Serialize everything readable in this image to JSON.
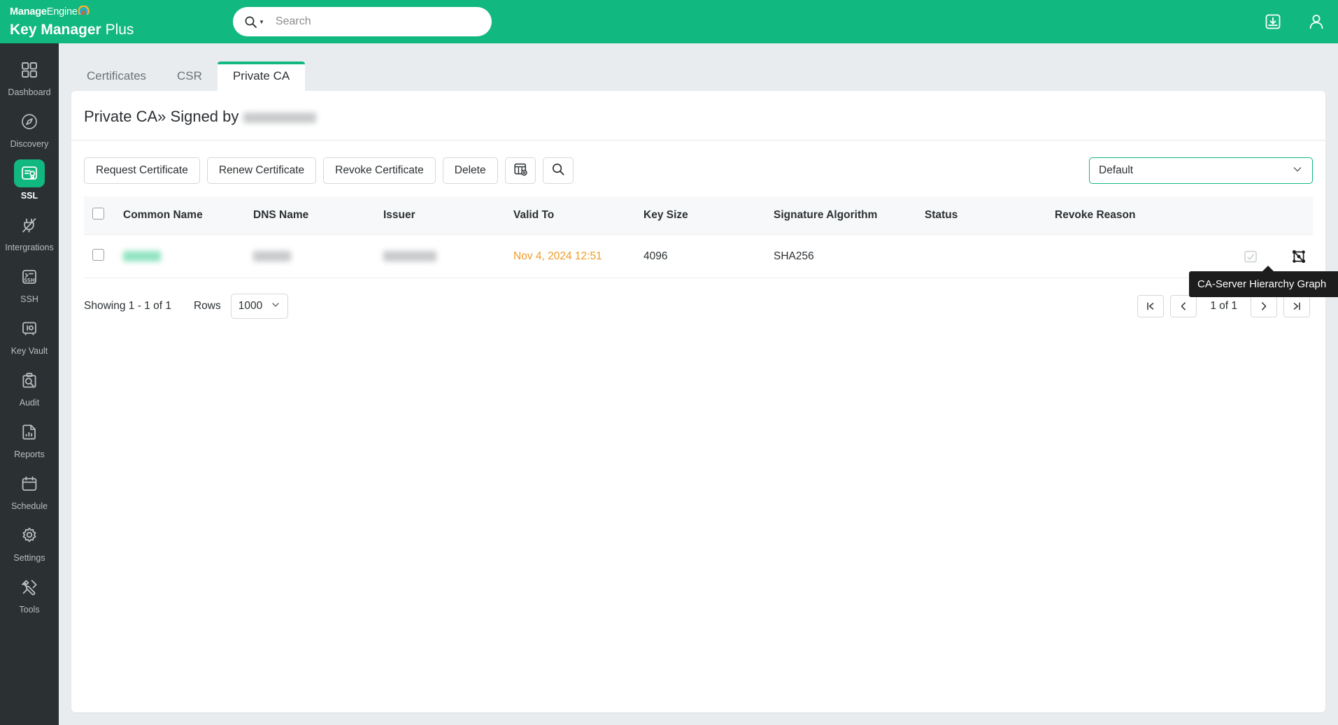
{
  "brand": {
    "company_bold": "Manage",
    "company_thin": "Engine",
    "product_bold": "Key Manager",
    "product_thin": "Plus"
  },
  "search": {
    "placeholder": "Search",
    "value": "",
    "icon": "search-icon",
    "caret_icon": "caret-down-icon"
  },
  "topbar": {
    "actions": [
      {
        "name": "inbox-download-icon",
        "label": ""
      },
      {
        "name": "user-account-icon",
        "label": ""
      }
    ]
  },
  "sidebar": {
    "items": [
      {
        "label": "Dashboard",
        "icon": "grid-icon",
        "active": false
      },
      {
        "label": "Discovery",
        "icon": "compass-icon",
        "active": false
      },
      {
        "label": "SSL",
        "icon": "certificate-badge-icon",
        "active": true
      },
      {
        "label": "Intergrations",
        "icon": "plug-icon",
        "active": false
      },
      {
        "label": "SSH",
        "icon": "terminal-ssh-icon",
        "active": false
      },
      {
        "label": "Key Vault",
        "icon": "vault-icon",
        "active": false
      },
      {
        "label": "Audit",
        "icon": "clipboard-search-icon",
        "active": false
      },
      {
        "label": "Reports",
        "icon": "report-chart-icon",
        "active": false
      },
      {
        "label": "Schedule",
        "icon": "calendar-icon",
        "active": false
      },
      {
        "label": "Settings",
        "icon": "gear-icon",
        "active": false
      },
      {
        "label": "Tools",
        "icon": "tools-icon",
        "active": false
      }
    ]
  },
  "tabs": [
    {
      "label": "Certificates",
      "active": false
    },
    {
      "label": "CSR",
      "active": false
    },
    {
      "label": "Private CA",
      "active": true
    }
  ],
  "page": {
    "title_prefix": "Private CA",
    "title_separator": "»",
    "title_middle": "Signed by",
    "title_redacted": "testcaroot"
  },
  "toolbar": {
    "buttons": [
      {
        "label": "Request Certificate",
        "name": "request-certificate-button"
      },
      {
        "label": "Renew Certificate",
        "name": "renew-certificate-button"
      },
      {
        "label": "Revoke Certificate",
        "name": "revoke-certificate-button"
      },
      {
        "label": "Delete",
        "name": "delete-button"
      }
    ],
    "icon_buttons": [
      {
        "name": "column-settings-icon",
        "label": ""
      },
      {
        "name": "search-icon",
        "label": ""
      }
    ],
    "view_select": {
      "value": "Default",
      "chevron": "chevron-down-icon"
    }
  },
  "table": {
    "columns": [
      "Common Name",
      "DNS Name",
      "Issuer",
      "Valid To",
      "Key Size",
      "Signature Algorithm",
      "Status",
      "Revoke Reason"
    ],
    "rows": [
      {
        "common_name": "testsub",
        "common_name_redacted": true,
        "dns_name": "testsub",
        "dns_name_redacted": true,
        "issuer": "testcaroot",
        "issuer_redacted": true,
        "valid_to": "Nov 4, 2024 12:51",
        "key_size": "4096",
        "signature_algorithm": "SHA256",
        "status": "",
        "revoke_reason": "",
        "actions": [
          {
            "name": "certificate-details-icon",
            "enabled": false
          },
          {
            "name": "hierarchy-graph-icon",
            "enabled": true
          }
        ]
      }
    ]
  },
  "tooltip": {
    "text": "CA-Server Hierarchy Graph"
  },
  "footer": {
    "showing": "Showing 1 - 1 of 1",
    "rows_label": "Rows",
    "rows_value": "1000",
    "page_info": "1 of 1",
    "pager": [
      {
        "name": "first-page-button",
        "glyph": "first"
      },
      {
        "name": "prev-page-button",
        "glyph": "prev"
      },
      {
        "name": "next-page-button",
        "glyph": "next"
      },
      {
        "name": "last-page-button",
        "glyph": "last"
      }
    ]
  },
  "colors": {
    "brand_green": "#11b87f",
    "sidebar_dark": "#2b3033",
    "valid_to_orange": "#ee9b26",
    "page_bg": "#e9ecee"
  }
}
